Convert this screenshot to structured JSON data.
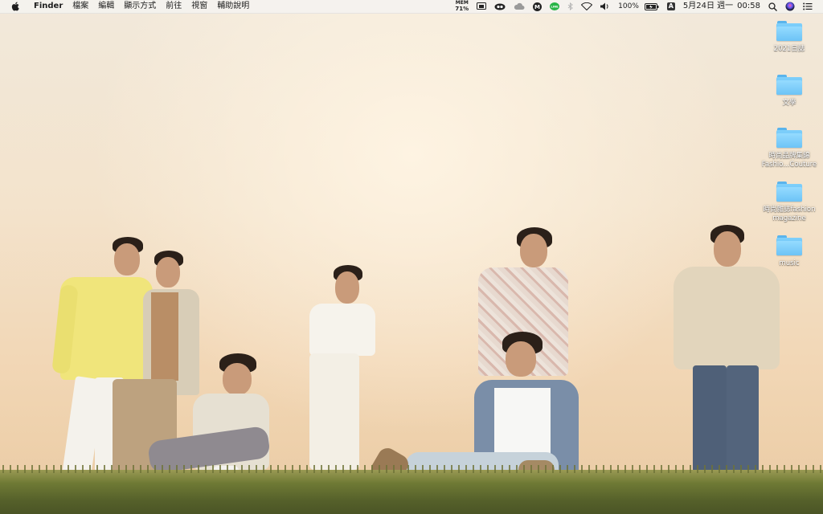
{
  "menubar": {
    "app_name": "Finder",
    "menus": [
      "檔案",
      "編輯",
      "顯示方式",
      "前往",
      "視窗",
      "輔助說明"
    ],
    "status": {
      "mem_label": "MEM",
      "mem_value": "71%",
      "battery_percent": "100%",
      "input_method": "A",
      "date": "5月24日 週一",
      "time": "00:58",
      "line_label": "LINE",
      "m_label": "M"
    }
  },
  "desktop": {
    "icons": [
      {
        "label": "2021日誌"
      },
      {
        "label": "文學"
      },
      {
        "label": "時尚品牌集錦 Fashio...Couture"
      },
      {
        "label": "時尚雜誌fashion magazine"
      },
      {
        "label": "music"
      }
    ]
  },
  "colors": {
    "folder": "#6cc3f6",
    "menubar_bg": "#f4f2ef",
    "sky_top": "#f2e9db",
    "sky_bottom": "#e9c9a3",
    "grass": "#5f6a2e"
  }
}
